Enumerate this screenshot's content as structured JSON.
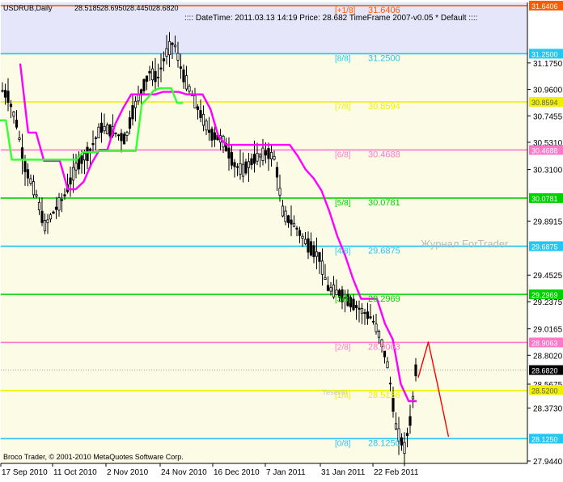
{
  "chart_data": {
    "type": "candlestick",
    "symbol_label": "USDRUB,Daily",
    "header_values": [
      "28.5185",
      "28.6950",
      "28.4450",
      "28.6820"
    ],
    "info_line": ":::: DateTime: 2011.03.13 14:19   Price: 28.682   TimeFrame 2007-v0.05    *  Default  ::::",
    "copyright": "Broco Trader, © 2001-2010 MetaQuotes Software Corp.",
    "watermark": "Журнал ForTrader",
    "watermark2": "Yesenin",
    "ylim": [
      27.944,
      31.64
    ],
    "price_ticks": [
      "31.1750",
      "30.9600",
      "30.7455",
      "30.5310",
      "30.3100",
      "29.8915",
      "29.4525",
      "29.2375",
      "29.0165",
      "28.8020",
      "28.5675",
      "28.3730",
      "27.9440"
    ],
    "date_ticks": [
      "17 Sep 2010",
      "11 Oct 2010",
      "2 Nov 2010",
      "24 Nov 2010",
      "16 Dec 2010",
      "7 Jan 2011",
      "31 Jan 2011",
      "22 Feb 2011"
    ],
    "current_price": "28.6820",
    "murrey_levels": [
      {
        "label": "[+1/8]",
        "value": "31.6406",
        "price": 31.6406,
        "color": "#ff5a00"
      },
      {
        "label": "[8/8]",
        "value": "31.2500",
        "price": 31.25,
        "color": "#26c6f0"
      },
      {
        "label": "[7/8]",
        "value": "30.8594",
        "price": 30.8594,
        "color": "#f0f000"
      },
      {
        "label": "[6/8]",
        "value": "30.4688",
        "price": 30.4688,
        "color": "#ff78c8"
      },
      {
        "label": "[5/8]",
        "value": "30.0781",
        "price": 30.0781,
        "color": "#00d000"
      },
      {
        "label": "[4/8]",
        "value": "29.6875",
        "price": 29.6875,
        "color": "#26c6f0"
      },
      {
        "label": "[3/8]",
        "value": "29.2969",
        "price": 29.2969,
        "color": "#00d000"
      },
      {
        "label": "[2/8]",
        "value": "28.9063",
        "price": 28.9063,
        "color": "#ff78c8"
      },
      {
        "label": "[1/8]",
        "value": "28.5156",
        "price": 28.5156,
        "color": "#f0f000"
      },
      {
        "label": "[0/8]",
        "value": "28.1250",
        "price": 28.125,
        "color": "#26c6f0"
      }
    ],
    "axis_level_labels": [
      "31.6406",
      "31.2500",
      "30.8594",
      "30.4688",
      "30.0781",
      "29.6875",
      "29.2969",
      "28.9063",
      "28.6820",
      "28.5200",
      "28.1250"
    ],
    "colors": {
      "background": "#fbfbe6",
      "top_band": "#e6e6fa",
      "candle": "#000000",
      "magenta_line": "#ff00ff",
      "green_line": "#33ff33",
      "forecast": "#ff0000"
    },
    "magenta_series": [
      [
        31.17,
        30.61,
        30.61,
        30.38,
        30.38,
        30.38,
        30.15,
        30.15,
        30.21,
        30.36,
        30.47,
        30.47,
        30.68,
        30.81,
        30.92,
        30.92,
        30.92,
        30.92,
        30.94,
        30.94,
        30.94,
        30.92,
        30.92,
        30.92,
        30.8,
        30.58,
        30.51,
        30.51,
        30.51,
        30.51,
        30.51,
        30.51,
        30.51,
        30.51,
        30.51,
        30.42,
        30.31,
        30.24,
        30.14,
        29.97,
        29.77,
        29.61,
        29.42,
        29.26,
        29.26,
        29.26,
        29.06,
        28.93,
        28.57,
        28.43,
        28.43
      ]
    ],
    "green_series": [
      [
        30.71,
        30.71,
        30.39,
        30.39,
        30.39,
        30.39,
        30.39,
        30.39,
        30.39,
        30.39,
        30.39,
        30.39,
        30.39,
        30.39,
        30.45,
        30.45,
        30.45,
        30.46,
        30.46,
        30.46,
        30.46,
        30.46,
        30.46,
        30.46,
        30.84,
        30.89,
        30.95,
        30.97,
        30.97,
        30.97,
        30.85,
        30.85
      ]
    ],
    "forecast_series": [
      [
        28.62,
        28.91,
        28.53,
        28.14
      ]
    ]
  }
}
